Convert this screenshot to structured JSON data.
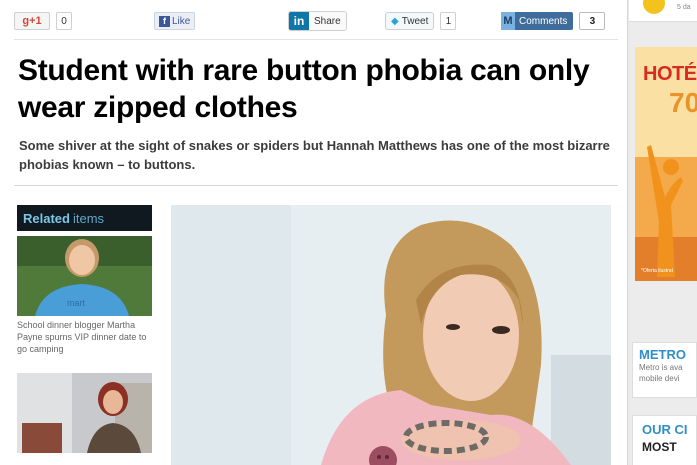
{
  "share_bar": {
    "google_plus": {
      "label": "+1",
      "count": "0"
    },
    "facebook": {
      "label": "Like"
    },
    "linkedin": {
      "label": "Share"
    },
    "twitter": {
      "label": "Tweet",
      "count": "1"
    },
    "comments": {
      "label": "Comments",
      "count": "3"
    }
  },
  "article": {
    "headline": "Student with rare button phobia can only wear zipped clothes",
    "standfirst": "Some shiver at the sight of snakes or spiders but Hannah Matthews has one of the most bizarre phobias known – to buttons."
  },
  "related": {
    "heading_strong": "Related",
    "heading_rest": "items",
    "items": [
      {
        "caption": "School dinner blogger Martha Payne spurns VIP dinner date to go camping"
      },
      {
        "caption": ""
      }
    ]
  },
  "right_rail": {
    "top_snippet": "5 da",
    "ad": {
      "headline": "HOTÉ",
      "number": "70",
      "legal": "*Oferta ilustrat"
    },
    "metro_box": {
      "title": "METRO",
      "line1": "Metro is ava",
      "line2": "mobile devi"
    },
    "our_box": {
      "title": "OUR CI",
      "subtitle": "MOST"
    }
  },
  "colors": {
    "headline": "#000000",
    "related_header_bg": "#101820",
    "related_accent": "#7cc7e8",
    "metro_blue": "#2e8fc8",
    "comments_button": "#3f6d9b"
  },
  "icons": [
    "google-plus-icon",
    "facebook-icon",
    "linkedin-icon",
    "twitter-bird-icon",
    "comments-m-icon",
    "sun-icon"
  ]
}
